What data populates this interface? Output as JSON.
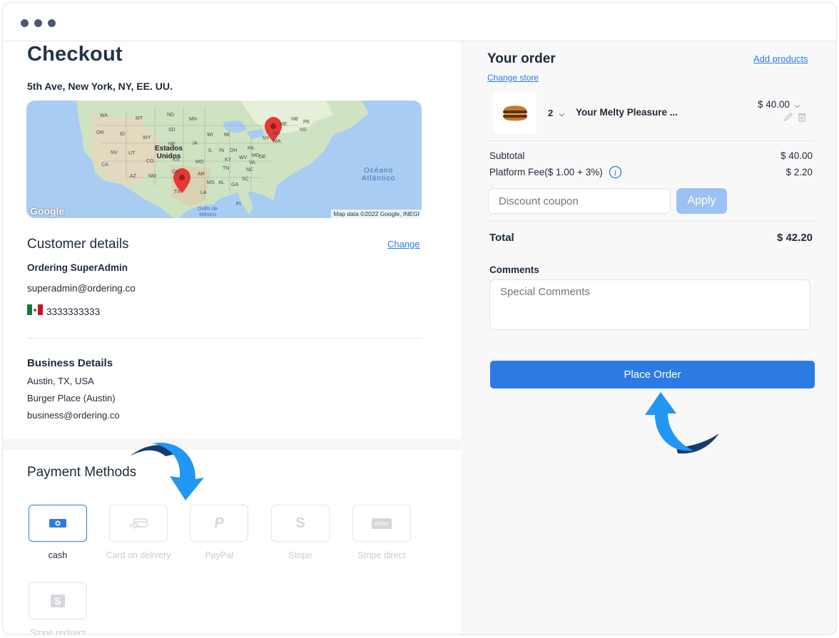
{
  "checkout": {
    "title": "Checkout",
    "address": "5th Ave, New York, NY, EE. UU."
  },
  "map": {
    "labels": {
      "country": "Estados\nUnidos",
      "ocean": "Océano\nAtlántico",
      "gulf": "Golfo de\nMéxico",
      "states": [
        "WA",
        "MT",
        "ND",
        "MN",
        "OR",
        "ID",
        "SD",
        "WY",
        "WI",
        "MI",
        "NE",
        "IA",
        "NV",
        "UT",
        "IL",
        "IN",
        "OH",
        "PA",
        "CO",
        "KS",
        "MO",
        "KY",
        "WV",
        "CA",
        "OK",
        "AR",
        "TN",
        "NC",
        "VA",
        "AZ",
        "NM",
        "MS",
        "AL",
        "GA",
        "SC",
        "TX",
        "LA",
        "FL",
        "NY",
        "ME",
        "NB",
        "PE",
        "NS",
        "MD",
        "DE",
        "NH",
        "MA"
      ]
    },
    "attribution": "Map data ©2022 Google, INEGI",
    "logo": "Google"
  },
  "customer": {
    "section_title": "Customer details",
    "change_label": "Change",
    "name": "Ordering SuperAdmin",
    "email": "superadmin@ordering.co",
    "phone": "3333333333"
  },
  "business": {
    "section_title": "Business Details",
    "location": "Austin, TX, USA",
    "name": "Burger Place (Austin)",
    "email": "business@ordering.co"
  },
  "payment": {
    "section_title": "Payment Methods",
    "methods": [
      {
        "label": "cash",
        "icon": "cash-icon",
        "active": true
      },
      {
        "label": "Card on delivery",
        "icon": "card-icon",
        "active": false
      },
      {
        "label": "PayPal",
        "icon": "paypal-icon",
        "active": false
      },
      {
        "label": "Stripe",
        "icon": "stripe-icon",
        "active": false
      },
      {
        "label": "Stripe direct",
        "icon": "stripe-direct-icon",
        "active": false
      },
      {
        "label": "Stripe redirect",
        "icon": "stripe-redirect-icon",
        "active": false
      }
    ],
    "stripe_badge": "stripe",
    "stripe_s": "S",
    "paypal_p": "P"
  },
  "order": {
    "title": "Your order",
    "add_products": "Add products",
    "change_store": "Change store",
    "item": {
      "quantity": "2",
      "name": "Your Melty Pleasure ...",
      "price": "$ 40.00"
    },
    "subtotal_label": "Subtotal",
    "subtotal_value": "$ 40.00",
    "fee_label": "Platform Fee($ 1.00 + 3%)",
    "fee_value": "$ 2.20",
    "coupon_placeholder": "Discount coupon",
    "apply_label": "Apply",
    "total_label": "Total",
    "total_value": "$ 42.20",
    "comments_label": "Comments",
    "comments_placeholder": "Special Comments",
    "place_order": "Place Order"
  },
  "colors": {
    "primary": "#2c7be5",
    "apply_disabled": "#9cc2f3",
    "text": "#1e2a39",
    "arrow_light": "#2196f3",
    "arrow_dark": "#143c6e"
  }
}
